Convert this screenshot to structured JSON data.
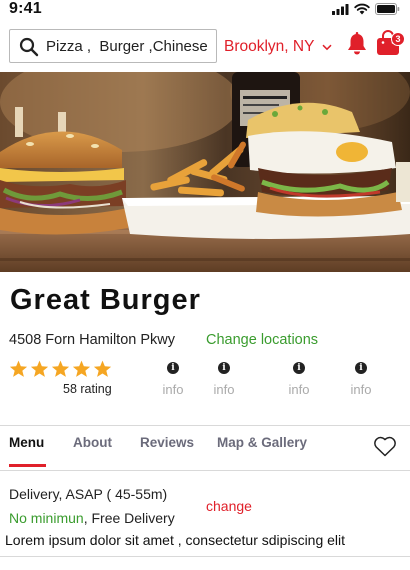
{
  "status": {
    "time": "9:41"
  },
  "search": {
    "value": "Pizza ,  Burger ,Chinese"
  },
  "location": {
    "label": "Brooklyn, NY"
  },
  "cart": {
    "badge": "3"
  },
  "restaurant": {
    "name": "Great Burger",
    "address": "4508 Forn Hamilton Pkwy",
    "change_location": "Change locations",
    "stars": 5,
    "rating_text": "58 rating"
  },
  "info_items": [
    "info",
    "info",
    "info",
    "info"
  ],
  "tabs": [
    "Menu",
    "About",
    "Reviews",
    "Map & Gallery"
  ],
  "delivery": {
    "line": "Delivery, ASAP ( 45-55m)",
    "change": "change",
    "minimum": "No minimun",
    "fee": ", Free Delivery",
    "description": "Lorem ipsum dolor sit amet , consectetur  sdipiscing elit"
  },
  "colors": {
    "accent": "#e0202a",
    "green": "#3a9c2e",
    "star": "#f5a623"
  },
  "icons": [
    "signal-icon",
    "wifi-icon",
    "battery-icon",
    "search-icon",
    "chevron-down-icon",
    "bell-icon",
    "shopping-bag-icon",
    "star-icon",
    "info-icon",
    "heart-icon"
  ]
}
